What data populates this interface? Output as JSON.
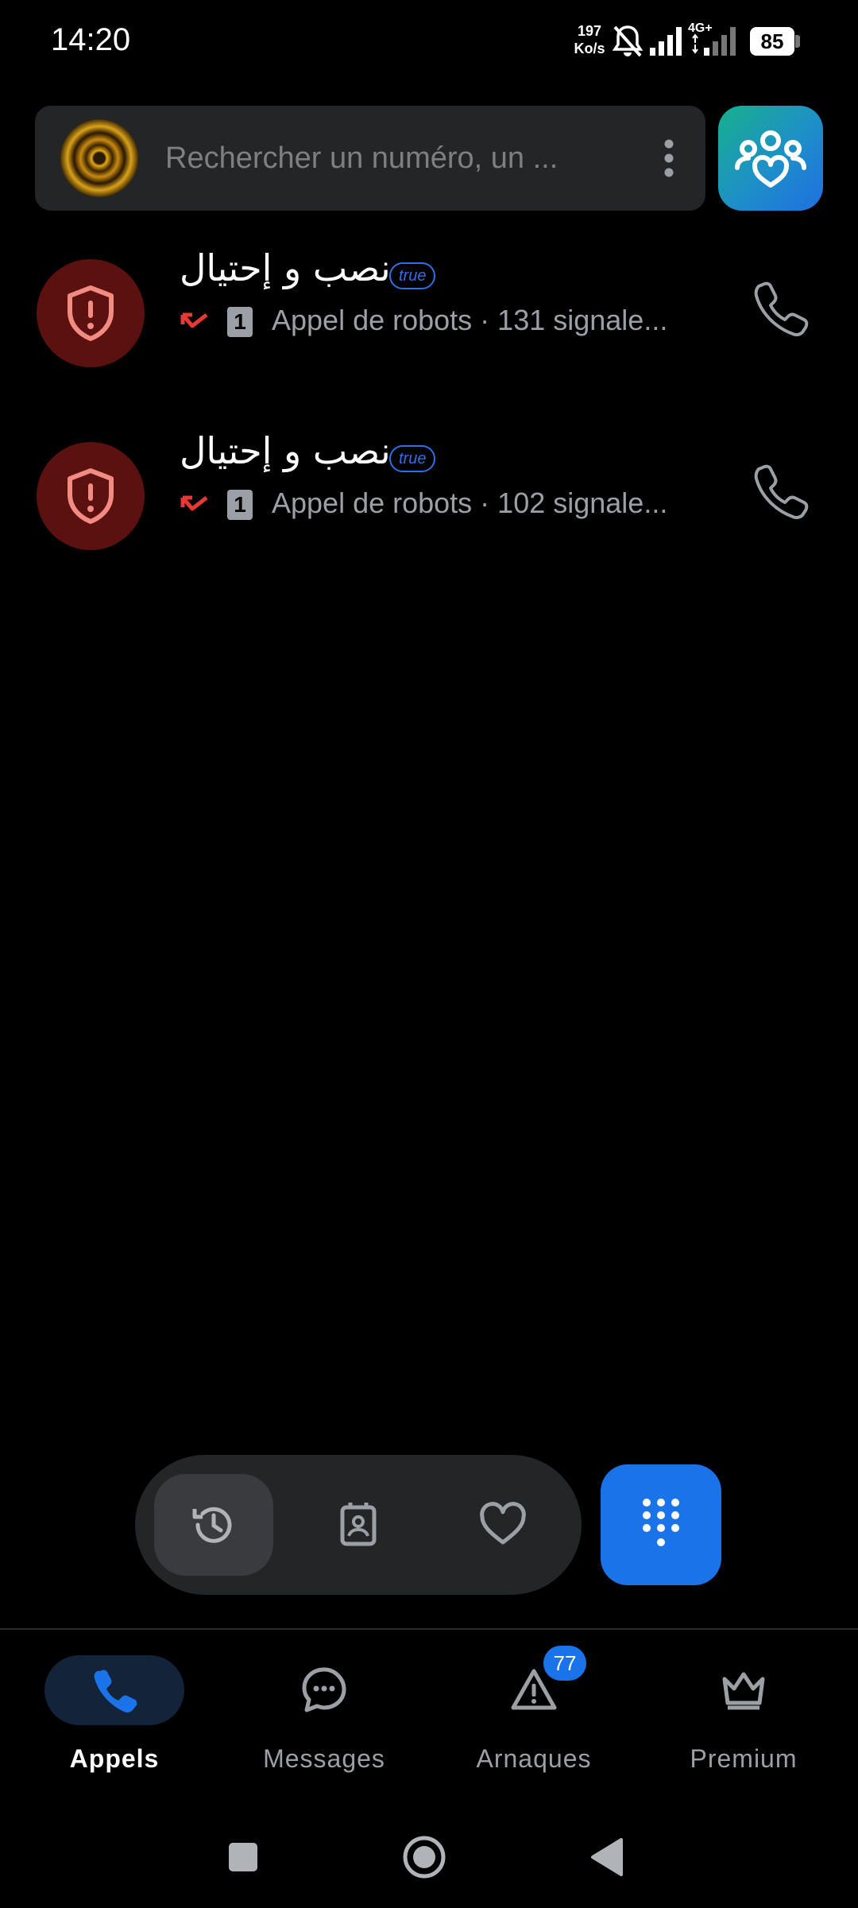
{
  "status_bar": {
    "time": "14:20",
    "net_speed_value": "197",
    "net_speed_unit": "Ko/s",
    "network": "4G+",
    "battery": "85"
  },
  "search": {
    "placeholder": "Rechercher un numéro, un ..."
  },
  "calls": [
    {
      "name": "نصب و إحتيال",
      "tag": "true",
      "description": "Appel de robots · 131 signale...",
      "sim": "1"
    },
    {
      "name": "نصب و إحتيال",
      "tag": "true",
      "description": "Appel de robots · 102 signale...",
      "sim": "1"
    }
  ],
  "bottom_nav": {
    "items": [
      {
        "label": "Appels",
        "icon": "phone-icon",
        "active": true
      },
      {
        "label": "Messages",
        "icon": "chat-bubble-icon",
        "active": false
      },
      {
        "label": "Arnaques",
        "icon": "warning-icon",
        "active": false,
        "badge": "77"
      },
      {
        "label": "Premium",
        "icon": "crown-icon",
        "active": false
      }
    ]
  },
  "colors": {
    "accent": "#1a73e8",
    "danger": "#e53935",
    "surface": "#242527",
    "background": "#000000"
  }
}
